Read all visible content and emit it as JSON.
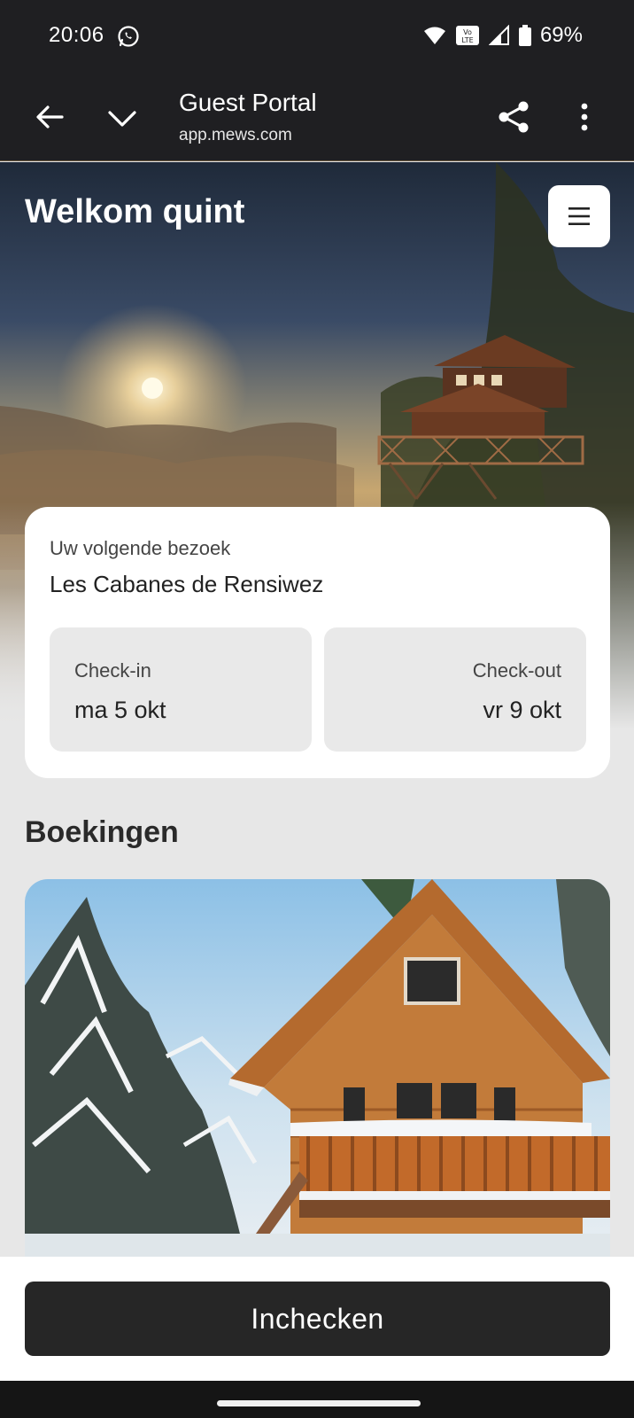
{
  "status_bar": {
    "time": "20:06",
    "battery": "69%",
    "icons": [
      "whatsapp-icon",
      "wifi-icon",
      "volte-icon",
      "signal-icon",
      "battery-icon"
    ]
  },
  "browser": {
    "title": "Guest Portal",
    "url": "app.mews.com",
    "icons": [
      "back-arrow-icon",
      "chevron-down-icon",
      "share-icon",
      "more-vert-icon"
    ]
  },
  "hero": {
    "welcome": "Welkom quint",
    "menu_icon": "hamburger-menu-icon"
  },
  "visit": {
    "label": "Uw volgende bezoek",
    "property": "Les Cabanes de Rensiwez",
    "checkin_label": "Check-in",
    "checkin_date": "ma 5 okt",
    "checkout_label": "Check-out",
    "checkout_date": "vr 9 okt"
  },
  "bookings": {
    "title": "Boekingen"
  },
  "action": {
    "checkin_button": "Inchecken"
  },
  "colors": {
    "bar_bg": "#1f1f22",
    "button_bg": "#262626",
    "page_bg": "#e7e7e7",
    "date_box_bg": "#e9e9e9"
  }
}
